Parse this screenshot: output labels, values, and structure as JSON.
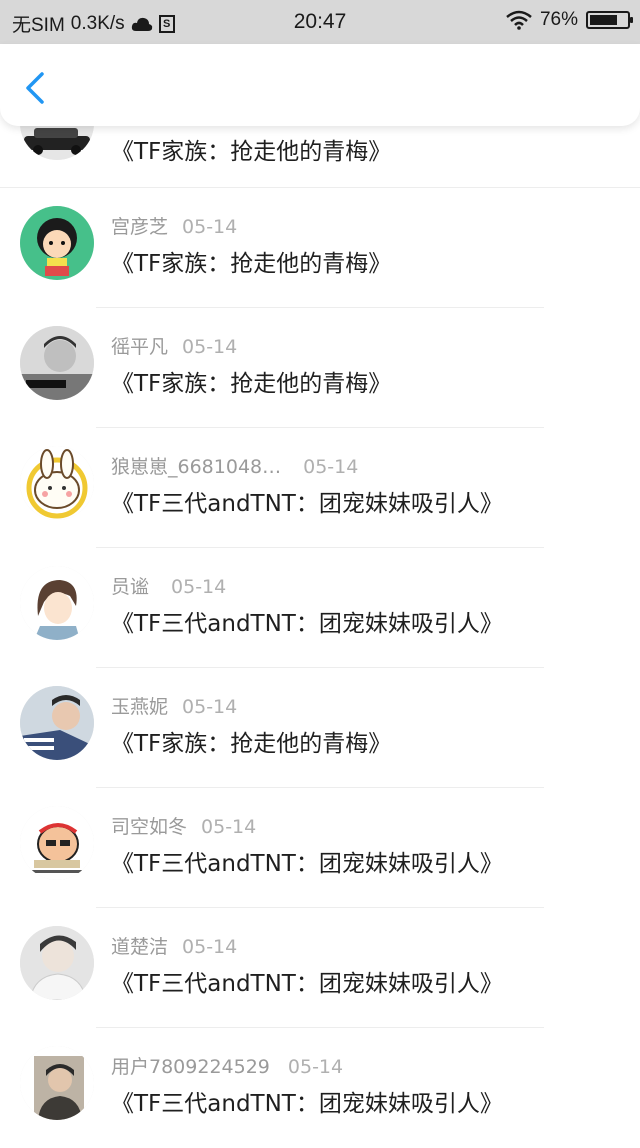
{
  "status_bar": {
    "carrier": "无SIM",
    "speed": "0.3K/s",
    "time": "20:47",
    "battery": "76%",
    "battery_level": 0.76
  },
  "header": {
    "back_icon": "chevron-left-icon"
  },
  "colors": {
    "accent": "#2196f3",
    "meta": "#9a9a9a",
    "title": "#1f1f1f"
  },
  "items": [
    {
      "name": "",
      "date": "",
      "title": "《TF家族：抢走他的青梅》",
      "avatar": "car-avatar"
    },
    {
      "name": "宫彦芝",
      "date": "05-14",
      "title": "《TF家族：抢走他的青梅》",
      "avatar": "cartoon-girl-avatar"
    },
    {
      "name": "徭平凡",
      "date": "05-14",
      "title": "《TF家族：抢走他的青梅》",
      "avatar": "boy-photo-avatar"
    },
    {
      "name": "狼崽崽_6681048…",
      "date": "05-14",
      "title": "《TF三代andTNT：团宠妹妹吸引人》",
      "avatar": "bunny-avatar"
    },
    {
      "name": "员谧",
      "date": "05-14",
      "title": "《TF三代andTNT：团宠妹妹吸引人》",
      "avatar": "anime-girl-avatar"
    },
    {
      "name": "玉燕妮",
      "date": "05-14",
      "title": "《TF家族：抢走他的青梅》",
      "avatar": "boy-photo-avatar"
    },
    {
      "name": "司空如冬",
      "date": "05-14",
      "title": "《TF三代andTNT：团宠妹妹吸引人》",
      "avatar": "meme-avatar"
    },
    {
      "name": "道楚洁",
      "date": "05-14",
      "title": "《TF三代andTNT：团宠妹妹吸引人》",
      "avatar": "boy-photo-avatar"
    },
    {
      "name": "用户7809224529",
      "date": "05-14",
      "title": "《TF三代andTNT：团宠妹妹吸引人》",
      "avatar": "boy-photo-avatar"
    }
  ]
}
